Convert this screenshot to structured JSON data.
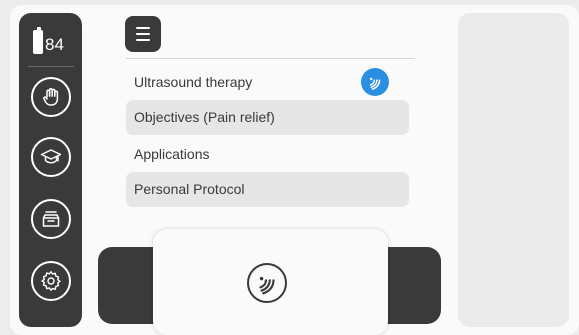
{
  "status": {
    "battery_level": "84"
  },
  "sidebar": {
    "items": [
      {
        "icon": "hand-icon"
      },
      {
        "icon": "graduation-cap-icon"
      },
      {
        "icon": "archive-tray-icon"
      },
      {
        "icon": "gear-icon"
      }
    ]
  },
  "menu": {
    "icon": "hamburger-menu-icon"
  },
  "list": {
    "items": [
      {
        "label": "Ultrasound therapy",
        "badge_icon": "ultrasound-icon"
      },
      {
        "label": "Objectives (Pain relief)"
      },
      {
        "label": "Applications"
      },
      {
        "label": "Personal Protocol"
      }
    ]
  },
  "bottom": {
    "action_icon": "ultrasound-icon"
  },
  "colors": {
    "dark": "#3a3a3a",
    "accent": "#2a8fe0",
    "background": "#fafafa",
    "row_shade": "#e6e6e6"
  }
}
